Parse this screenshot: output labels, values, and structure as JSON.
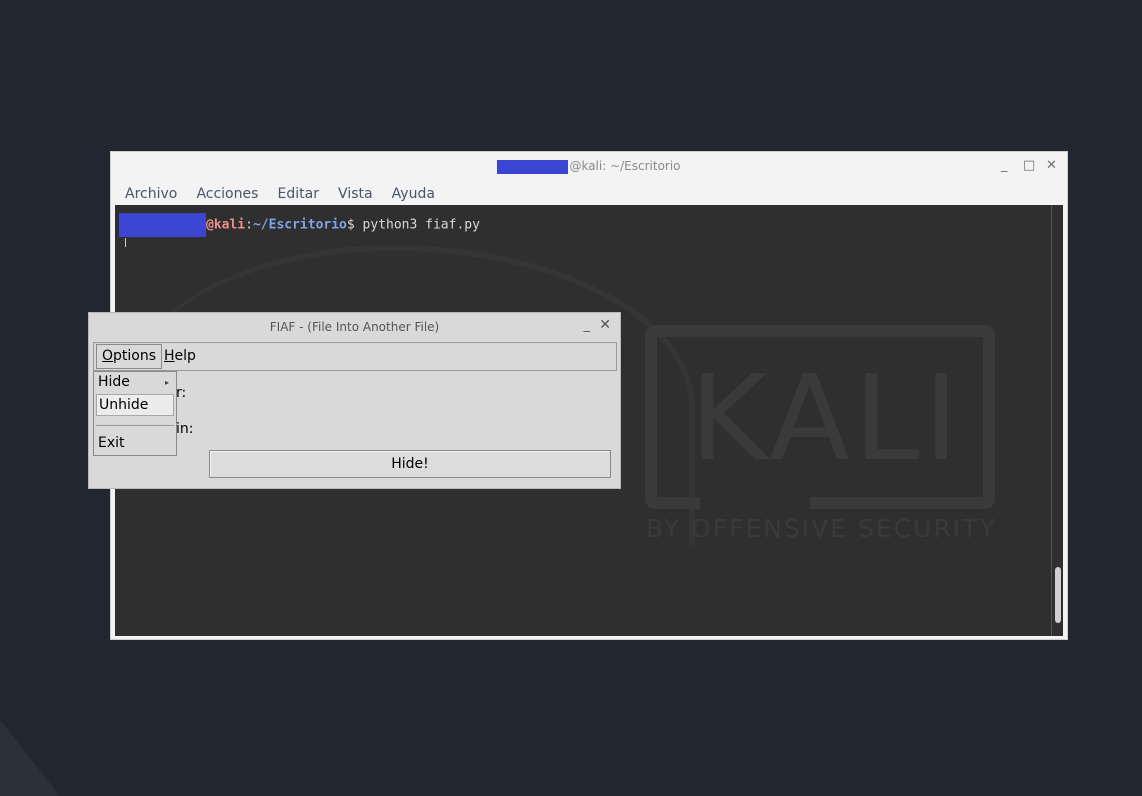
{
  "terminal": {
    "title": "@kali: ~/Escritorio",
    "window_buttons": {
      "minimize": "_",
      "maximize": "□",
      "close": "✕"
    },
    "menu": [
      "Archivo",
      "Acciones",
      "Editar",
      "Vista",
      "Ayuda"
    ],
    "prompt": {
      "host": "@kali",
      "sep": ":",
      "path": "~/Escritorio",
      "symbol": "$",
      "command": " python3 fiaf.py"
    },
    "background": {
      "logo_text": "KALI",
      "logo_subtext": "BY OFFENSIVE SECURITY"
    },
    "colors": {
      "redaction": "#3a46d2",
      "host": "#f08d8d",
      "path": "#7fa3e6",
      "body_bg": "#2f2f2f"
    }
  },
  "fiaf": {
    "title": "FIAF - (File Into Another File)",
    "window_buttons": {
      "minimize": "_",
      "close": "✕"
    },
    "menubar": {
      "options_first": "O",
      "options_rest": "ptions",
      "help_first": "H",
      "help_rest": "elp"
    },
    "partial_labels": [
      "r:",
      "in:"
    ],
    "hide_button": "Hide!",
    "options_menu": {
      "hide": "Hide",
      "unhide": "Unhide",
      "exit": "Exit",
      "submenu_arrow": "▸"
    }
  }
}
